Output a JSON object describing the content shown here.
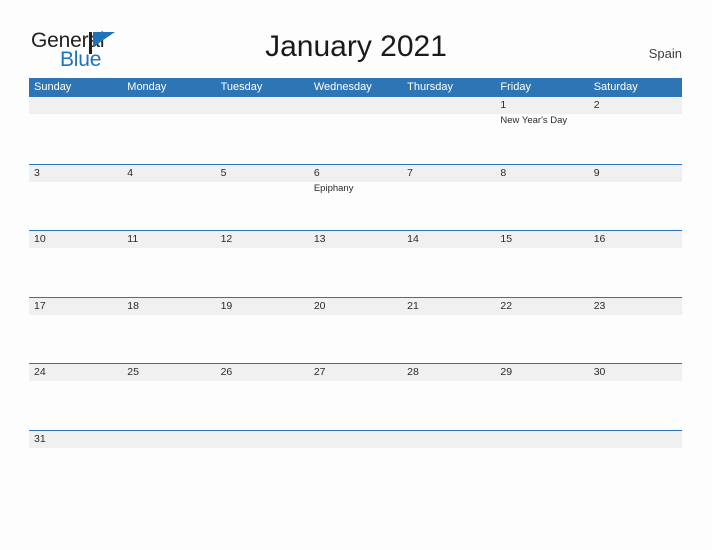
{
  "brand": {
    "name_part1": "General",
    "name_part2": "Blue",
    "flag_icon": "flag-icon"
  },
  "header": {
    "title": "January 2021",
    "country": "Spain"
  },
  "colors": {
    "header_blue": "#2E75B6",
    "row_line_blue": "#2E75B6",
    "date_strip_gray": "#F0F0F0",
    "logo_blue": "#1E74BB",
    "text_dark": "#2B2B2B"
  },
  "calendar": {
    "weekday_headers": [
      "Sunday",
      "Monday",
      "Tuesday",
      "Wednesday",
      "Thursday",
      "Friday",
      "Saturday"
    ],
    "weeks": [
      [
        {
          "date": "",
          "events": []
        },
        {
          "date": "",
          "events": []
        },
        {
          "date": "",
          "events": []
        },
        {
          "date": "",
          "events": []
        },
        {
          "date": "",
          "events": []
        },
        {
          "date": "1",
          "events": [
            "New Year's Day"
          ]
        },
        {
          "date": "2",
          "events": []
        }
      ],
      [
        {
          "date": "3",
          "events": []
        },
        {
          "date": "4",
          "events": []
        },
        {
          "date": "5",
          "events": []
        },
        {
          "date": "6",
          "events": [
            "Epiphany"
          ]
        },
        {
          "date": "7",
          "events": []
        },
        {
          "date": "8",
          "events": []
        },
        {
          "date": "9",
          "events": []
        }
      ],
      [
        {
          "date": "10",
          "events": []
        },
        {
          "date": "11",
          "events": []
        },
        {
          "date": "12",
          "events": []
        },
        {
          "date": "13",
          "events": []
        },
        {
          "date": "14",
          "events": []
        },
        {
          "date": "15",
          "events": []
        },
        {
          "date": "16",
          "events": []
        }
      ],
      [
        {
          "date": "17",
          "events": []
        },
        {
          "date": "18",
          "events": []
        },
        {
          "date": "19",
          "events": []
        },
        {
          "date": "20",
          "events": []
        },
        {
          "date": "21",
          "events": []
        },
        {
          "date": "22",
          "events": []
        },
        {
          "date": "23",
          "events": []
        }
      ],
      [
        {
          "date": "24",
          "events": []
        },
        {
          "date": "25",
          "events": []
        },
        {
          "date": "26",
          "events": []
        },
        {
          "date": "27",
          "events": []
        },
        {
          "date": "28",
          "events": []
        },
        {
          "date": "29",
          "events": []
        },
        {
          "date": "30",
          "events": []
        }
      ],
      [
        {
          "date": "31",
          "events": []
        },
        {
          "date": "",
          "events": []
        },
        {
          "date": "",
          "events": []
        },
        {
          "date": "",
          "events": []
        },
        {
          "date": "",
          "events": []
        },
        {
          "date": "",
          "events": []
        },
        {
          "date": "",
          "events": []
        }
      ]
    ]
  }
}
